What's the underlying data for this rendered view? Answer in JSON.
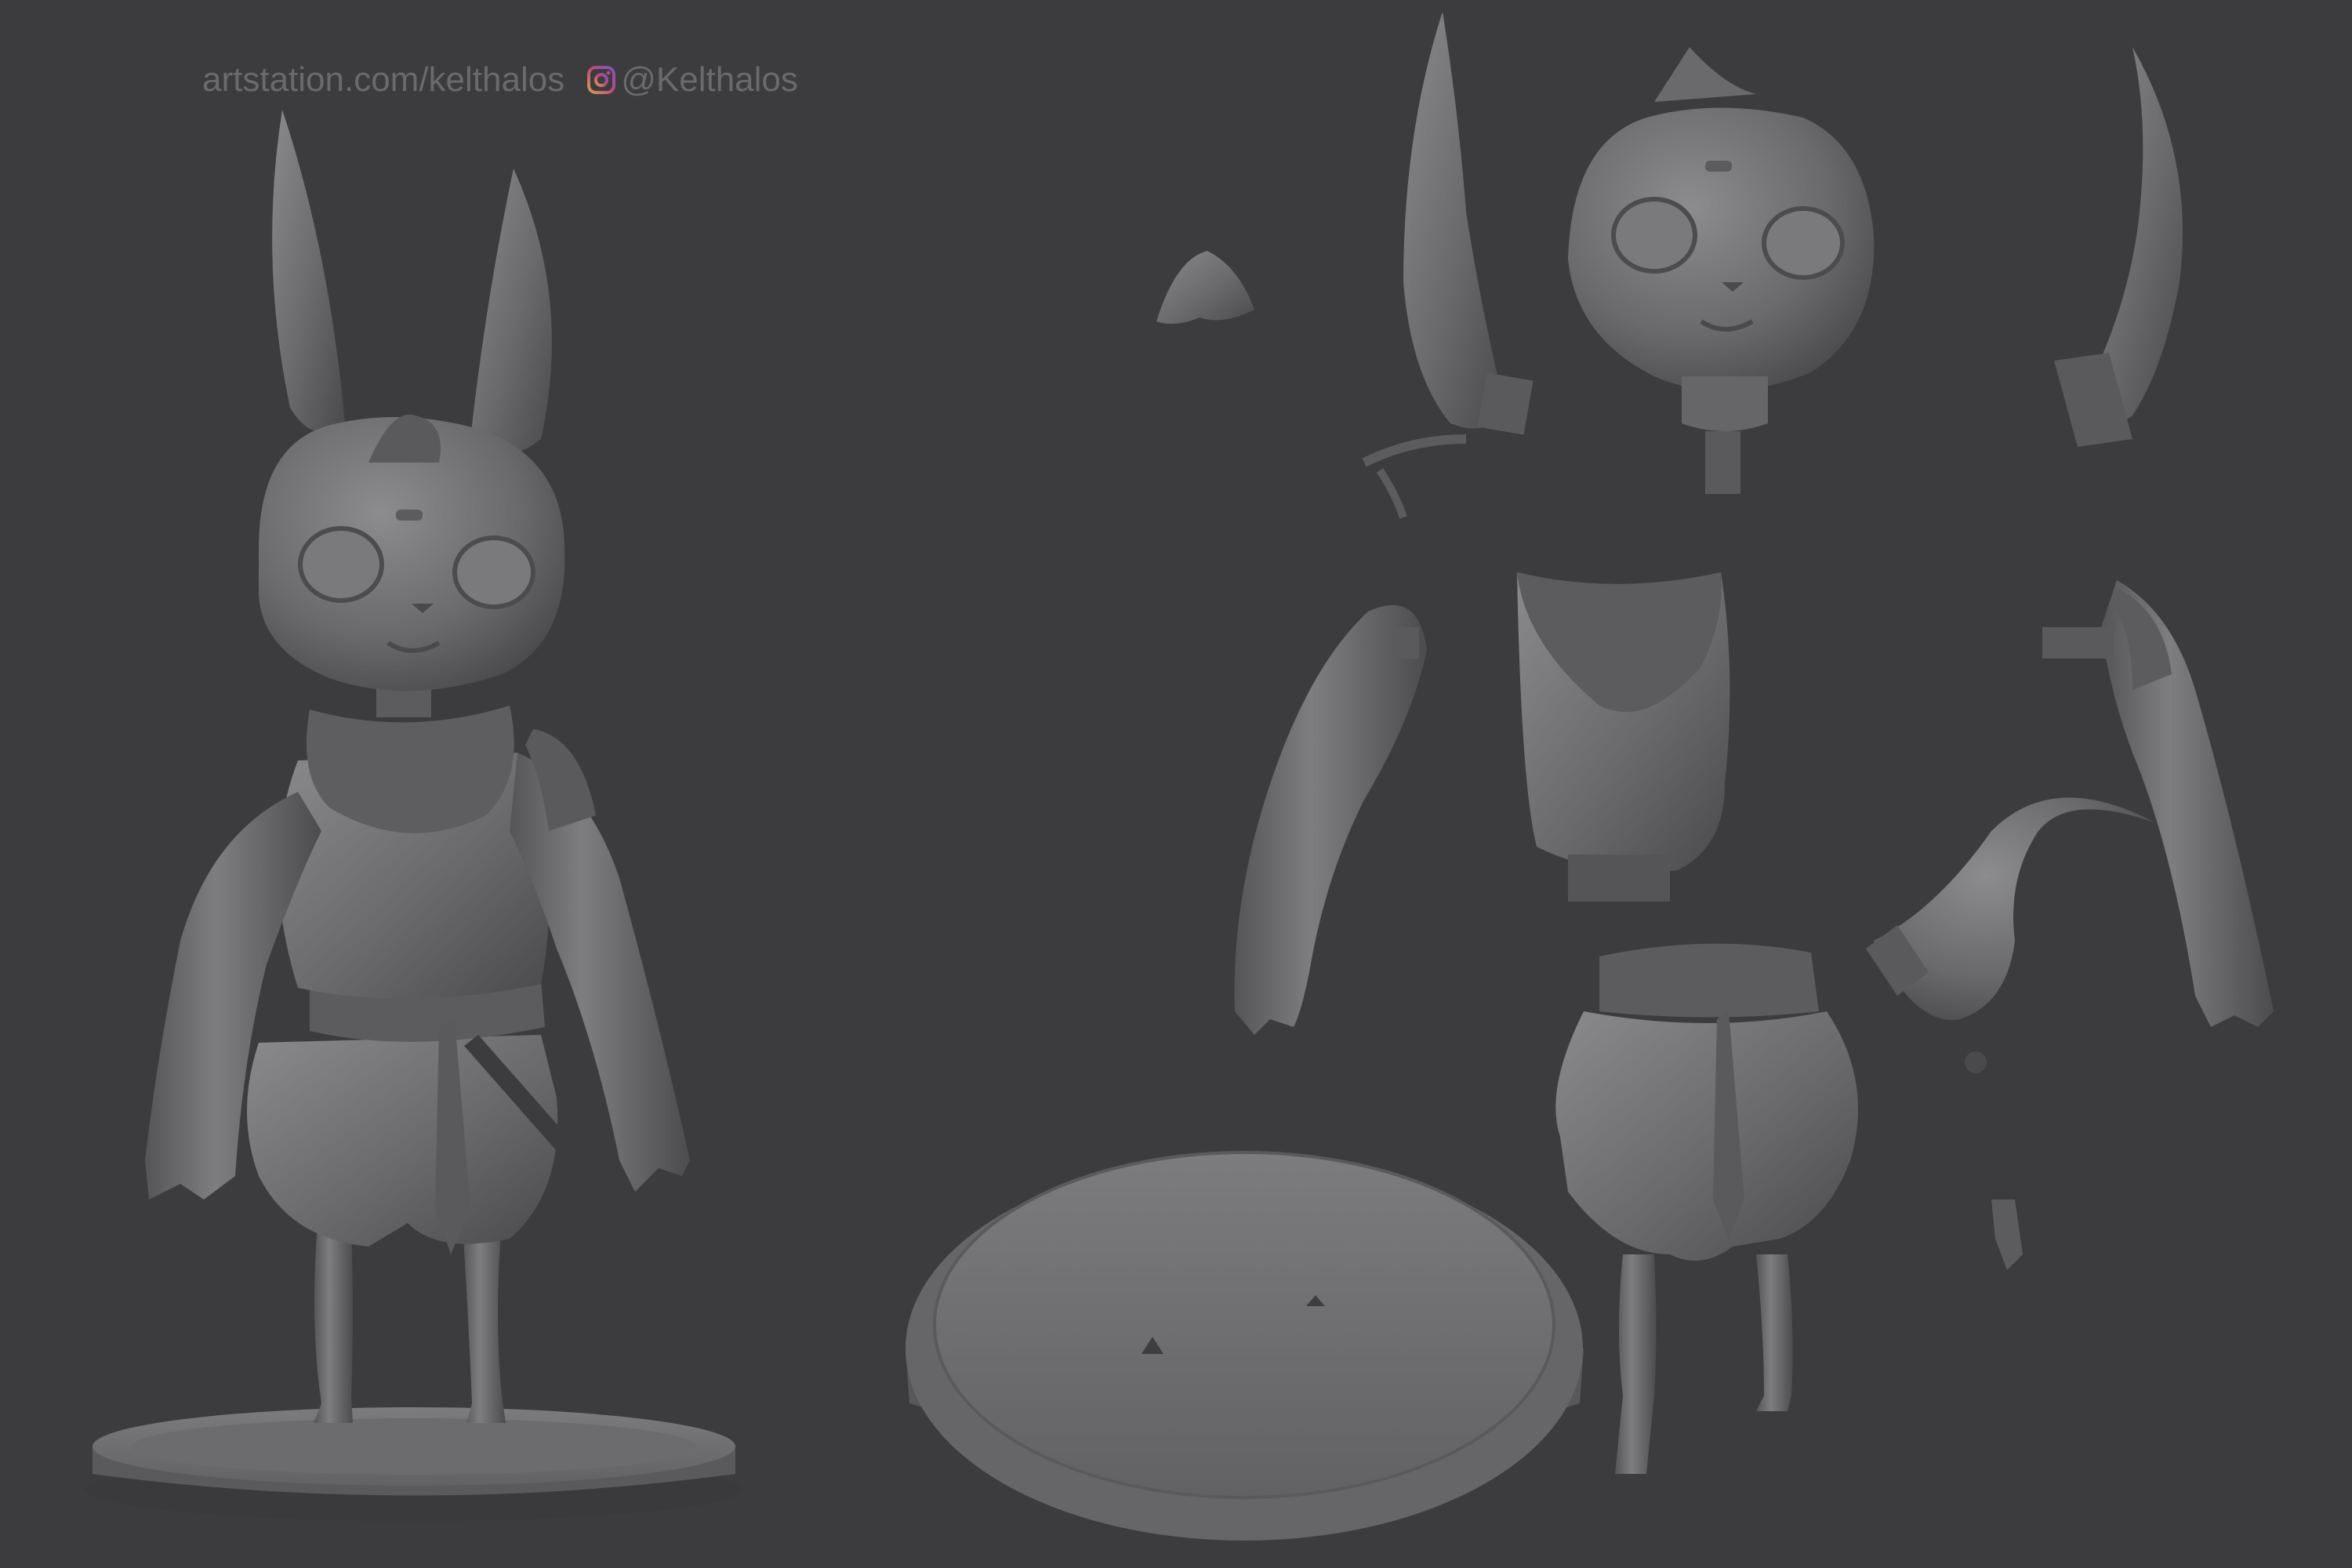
{
  "watermark": {
    "site": "artstation.com/kelthalos",
    "instagram_handle": "@Kelthalos",
    "instagram_icon": "instagram-icon"
  },
  "colors": {
    "background": "#3c3c3e",
    "clay": "#6b6b6d",
    "clay_light": "#858587",
    "clay_dark": "#444446",
    "watermark_text": "#6a6a6c"
  }
}
